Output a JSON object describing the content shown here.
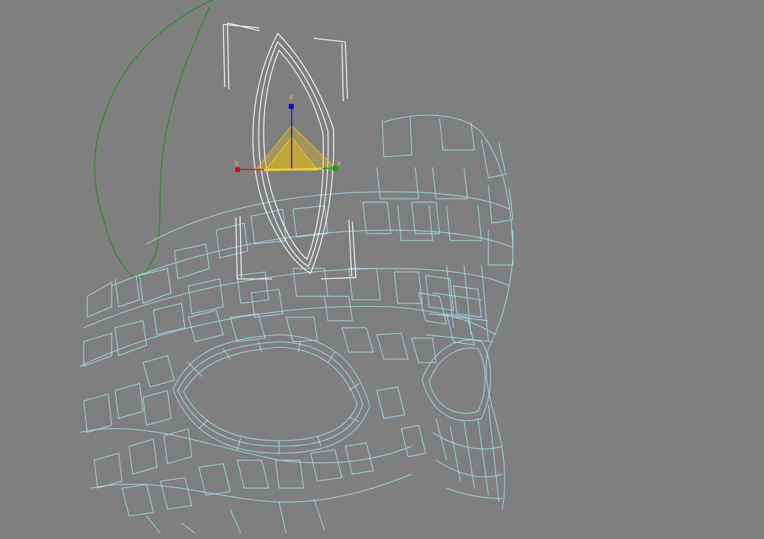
{
  "viewport": {
    "background": "#7f7f7f",
    "mesh_color": "#a8e4f0",
    "selected_color": "#ffffff",
    "curve_color": "#2e8a2e"
  },
  "gizmo": {
    "x_label": "x",
    "y_label": "y",
    "z_label": "z",
    "x_color": "#d01010",
    "y_color": "#10a010",
    "z_color": "#1010c0",
    "plane_color": "#e8c020",
    "label_color": "#f0d040"
  }
}
